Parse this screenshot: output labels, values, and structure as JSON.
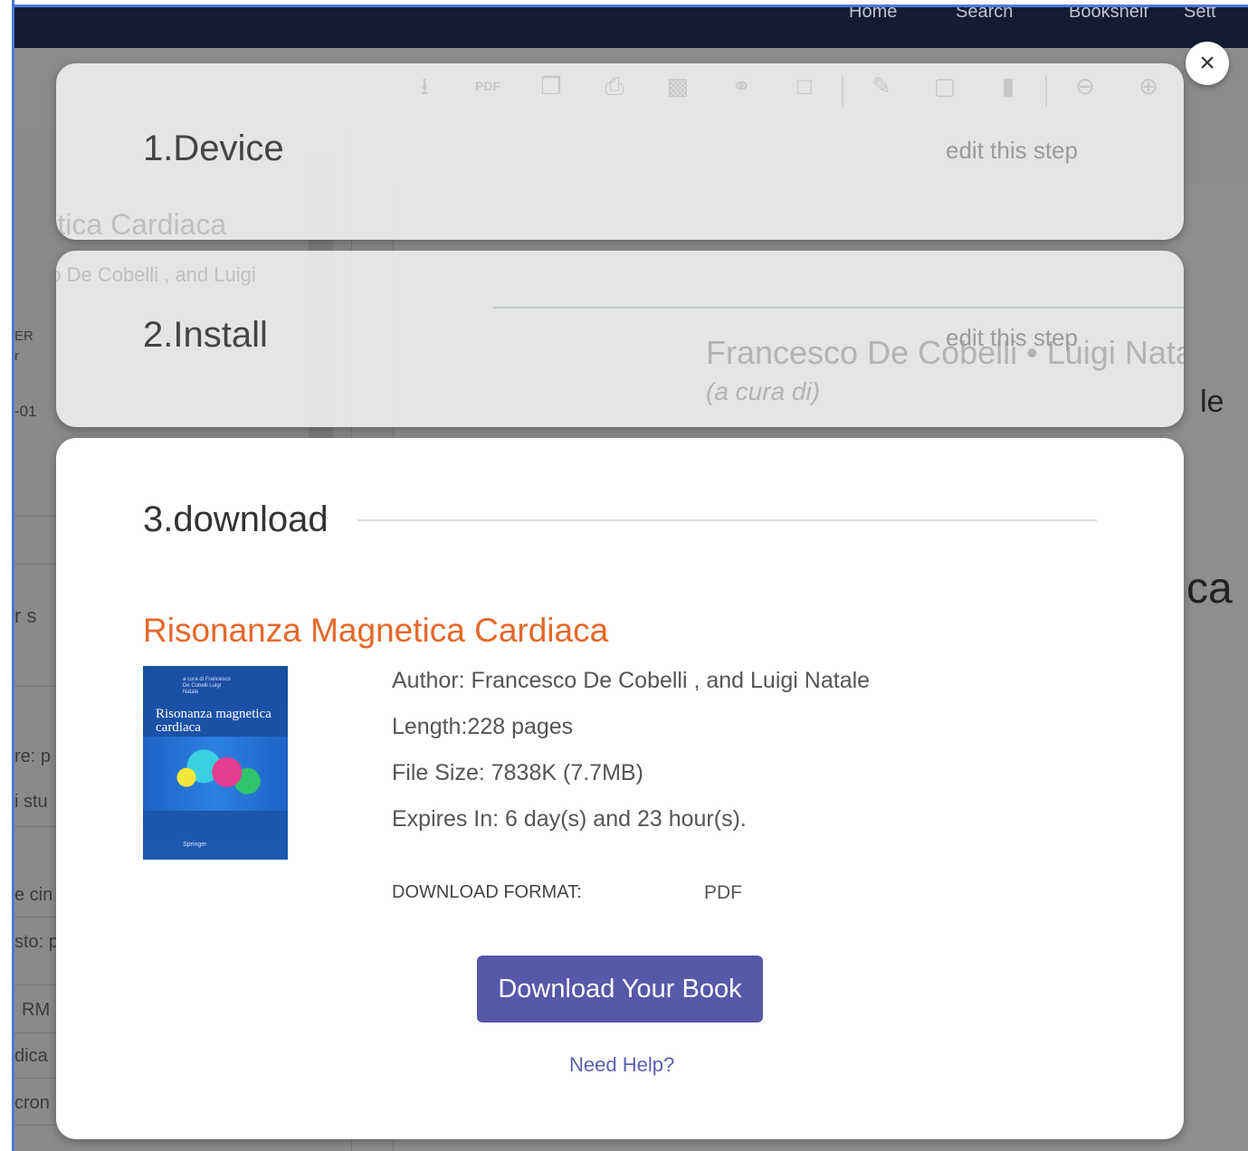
{
  "nav": {
    "items": [
      "Home",
      "Search",
      "Bookshelf",
      "Sett"
    ]
  },
  "background": {
    "title_partial": "gnetica Cardiaca",
    "authors_partial": "cesco De Cobelli , and Luigi",
    "cover_authors": "Francesco De Cobelli • Luigi Natale",
    "cover_editor": "(a cura di)",
    "side_fragments": [
      "ER",
      "r",
      "-01",
      "r s",
      "re: p",
      "i stu",
      "e cin",
      "sto: p",
      "RM",
      "dica",
      "cron"
    ],
    "big_text": "ca",
    "le_text": "le"
  },
  "modal": {
    "close_label": "×",
    "steps": [
      {
        "title": "1.Device",
        "edit_label": "edit this step"
      },
      {
        "title": "2.Install",
        "edit_label": "edit this step"
      },
      {
        "title": "3.download"
      }
    ],
    "book": {
      "title": "Risonanza Magnetica Cardiaca",
      "author": "Author: Francesco De Cobelli , and Luigi Natale",
      "length": "Length:228 pages",
      "file_size": "File Size: 7838K (7.7MB)",
      "expires": "Expires In: 6 day(s) and 23 hour(s).",
      "format_label": "DOWNLOAD FORMAT:",
      "format_value": "PDF",
      "cover": {
        "small_text": "a cura di Francesco De Cobelli Luigi Natale",
        "title": "Risonanza magnetica cardiaca",
        "publisher": "Springer"
      }
    },
    "download_button": "Download Your Book",
    "help_link": "Need Help?"
  }
}
